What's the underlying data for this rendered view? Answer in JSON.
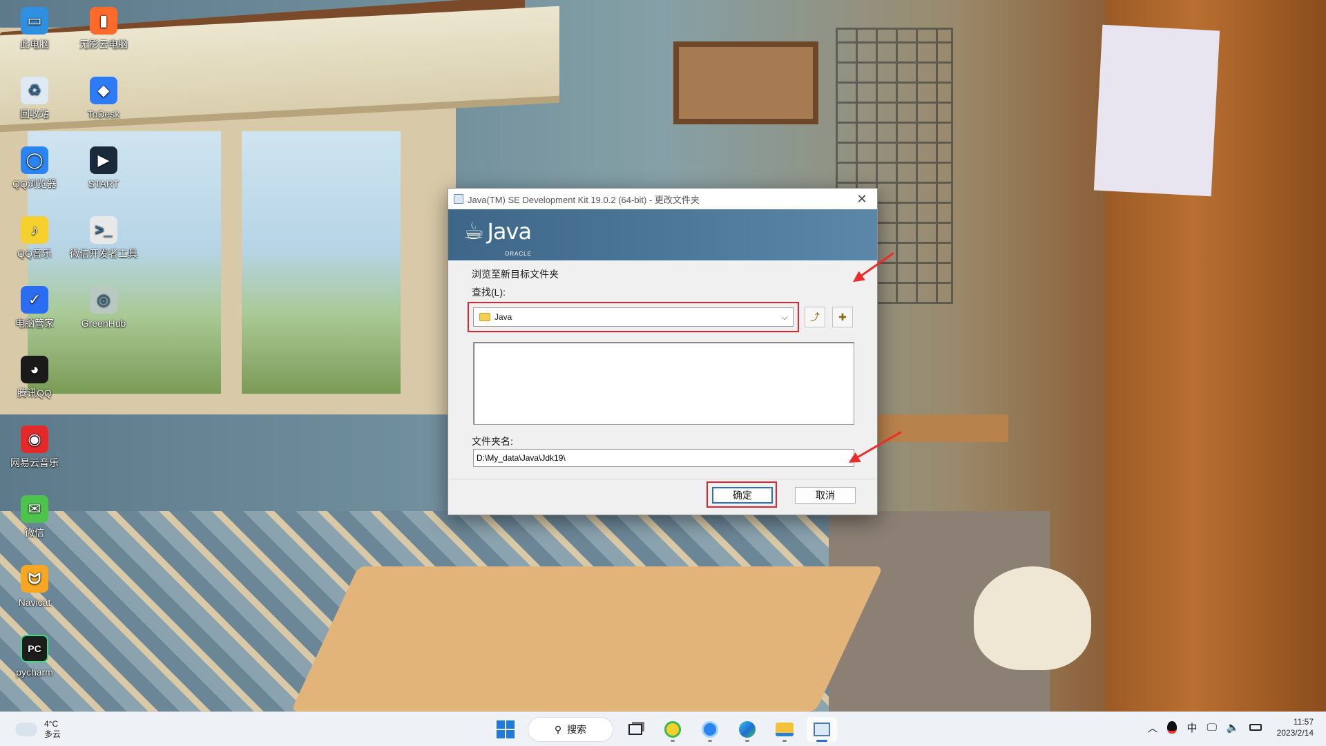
{
  "desktop": {
    "icons": [
      {
        "label": "此电脑",
        "icon": "computer-icon",
        "color": "#2f8fe0"
      },
      {
        "label": "无影云电脑",
        "icon": "cloud-pc-icon",
        "color": "#ff6a2a"
      },
      {
        "label": "回收站",
        "icon": "recycle-bin-icon",
        "color": "#dfe9f4"
      },
      {
        "label": "ToDesk",
        "icon": "todesk-icon",
        "color": "#2e7bf6"
      },
      {
        "label": "QQ浏览器",
        "icon": "qq-browser-icon",
        "color": "#2a85f0"
      },
      {
        "label": "START",
        "icon": "start-app-icon",
        "color": "#1b2a3a"
      },
      {
        "label": "QQ音乐",
        "icon": "qq-music-icon",
        "color": "#f6d12d"
      },
      {
        "label": "微信开发者工具",
        "icon": "wechat-devtools-icon",
        "color": "#e8e8e8"
      },
      {
        "label": "电脑管家",
        "icon": "pc-manager-icon",
        "color": "#2a6df0"
      },
      {
        "label": "GreenHub",
        "icon": "greenhub-icon",
        "color": "#b9c8c0"
      },
      {
        "label": "腾讯QQ",
        "icon": "tencent-qq-icon",
        "color": "#1a1a1a"
      },
      {
        "label": "网易云音乐",
        "icon": "netease-music-icon",
        "color": "#e32a2a"
      },
      {
        "label": "微信",
        "icon": "wechat-icon",
        "color": "#4dc24d"
      },
      {
        "label": "Navicat",
        "icon": "navicat-icon",
        "color": "#f5a623"
      },
      {
        "label": "pycharm",
        "icon": "pycharm-icon",
        "color": "#1d1d1d"
      }
    ]
  },
  "dialog": {
    "title": "Java(TM) SE Development Kit 19.0.2 (64-bit) - 更改文件夹",
    "logo_text": "Java",
    "logo_sub": "ORACLE",
    "browse_label": "浏览至新目标文件夹",
    "lookin_label": "查找(L):",
    "lookin_value": "Java",
    "folder_name_label": "文件夹名:",
    "folder_name_value": "D:\\My_data\\Java\\Jdk19\\",
    "ok_label": "确定",
    "cancel_label": "取消",
    "highlight_color": "#e3232f"
  },
  "taskbar": {
    "weather_temp": "4°C",
    "weather_desc": "多云",
    "search_label": "搜索",
    "tray_ime": "中",
    "time": "11:57",
    "date": "2023/2/14"
  }
}
